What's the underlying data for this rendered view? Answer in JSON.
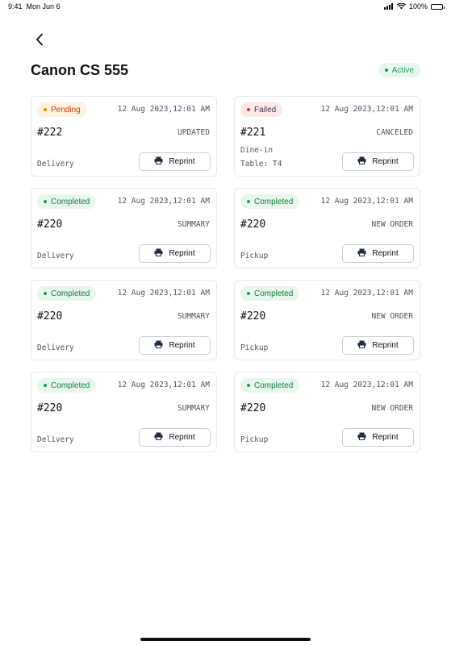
{
  "status_bar": {
    "time": "9:41",
    "date": "Mon Jun 6",
    "battery": "100%"
  },
  "header": {
    "title": "Canon CS 555",
    "status": "Active"
  },
  "reprint_label": "Reprint",
  "orders": [
    {
      "status": "Pending",
      "status_kind": "pending",
      "datetime": "12 Aug 2023,12:01 AM",
      "number": "#222",
      "type": "UPDATED",
      "line1": "",
      "line2": "Delivery"
    },
    {
      "status": "Failed",
      "status_kind": "failed",
      "datetime": "12 Aug 2023,12:01 AM",
      "number": "#221",
      "type": "CANCELED",
      "line1": "Dine-in",
      "line2": "Table: T4"
    },
    {
      "status": "Completed",
      "status_kind": "completed",
      "datetime": "12 Aug 2023,12:01 AM",
      "number": "#220",
      "type": "SUMMARY",
      "line1": "",
      "line2": "Delivery"
    },
    {
      "status": "Completed",
      "status_kind": "completed",
      "datetime": "12 Aug 2023,12:01 AM",
      "number": "#220",
      "type": "NEW ORDER",
      "line1": "",
      "line2": "Pickup"
    },
    {
      "status": "Completed",
      "status_kind": "completed",
      "datetime": "12 Aug 2023,12:01 AM",
      "number": "#220",
      "type": "SUMMARY",
      "line1": "",
      "line2": "Delivery"
    },
    {
      "status": "Completed",
      "status_kind": "completed",
      "datetime": "12 Aug 2023,12:01 AM",
      "number": "#220",
      "type": "NEW ORDER",
      "line1": "",
      "line2": "Pickup"
    },
    {
      "status": "Completed",
      "status_kind": "completed",
      "datetime": "12 Aug 2023,12:01 AM",
      "number": "#220",
      "type": "SUMMARY",
      "line1": "",
      "line2": "Delivery"
    },
    {
      "status": "Completed",
      "status_kind": "completed",
      "datetime": "12 Aug 2023,12:01 AM",
      "number": "#220",
      "type": "NEW ORDER",
      "line1": "",
      "line2": "Pickup"
    }
  ],
  "colors": {
    "active_green": "#1f9d55",
    "pending_orange": "#e08a00",
    "failed_red": "#d93636",
    "border": "#e6e8eb"
  },
  "icons": {
    "back": "chevron-left-icon",
    "reprint": "printer-icon",
    "wifi": "wifi-icon",
    "signal": "cellular-signal-icon",
    "battery": "battery-icon"
  }
}
